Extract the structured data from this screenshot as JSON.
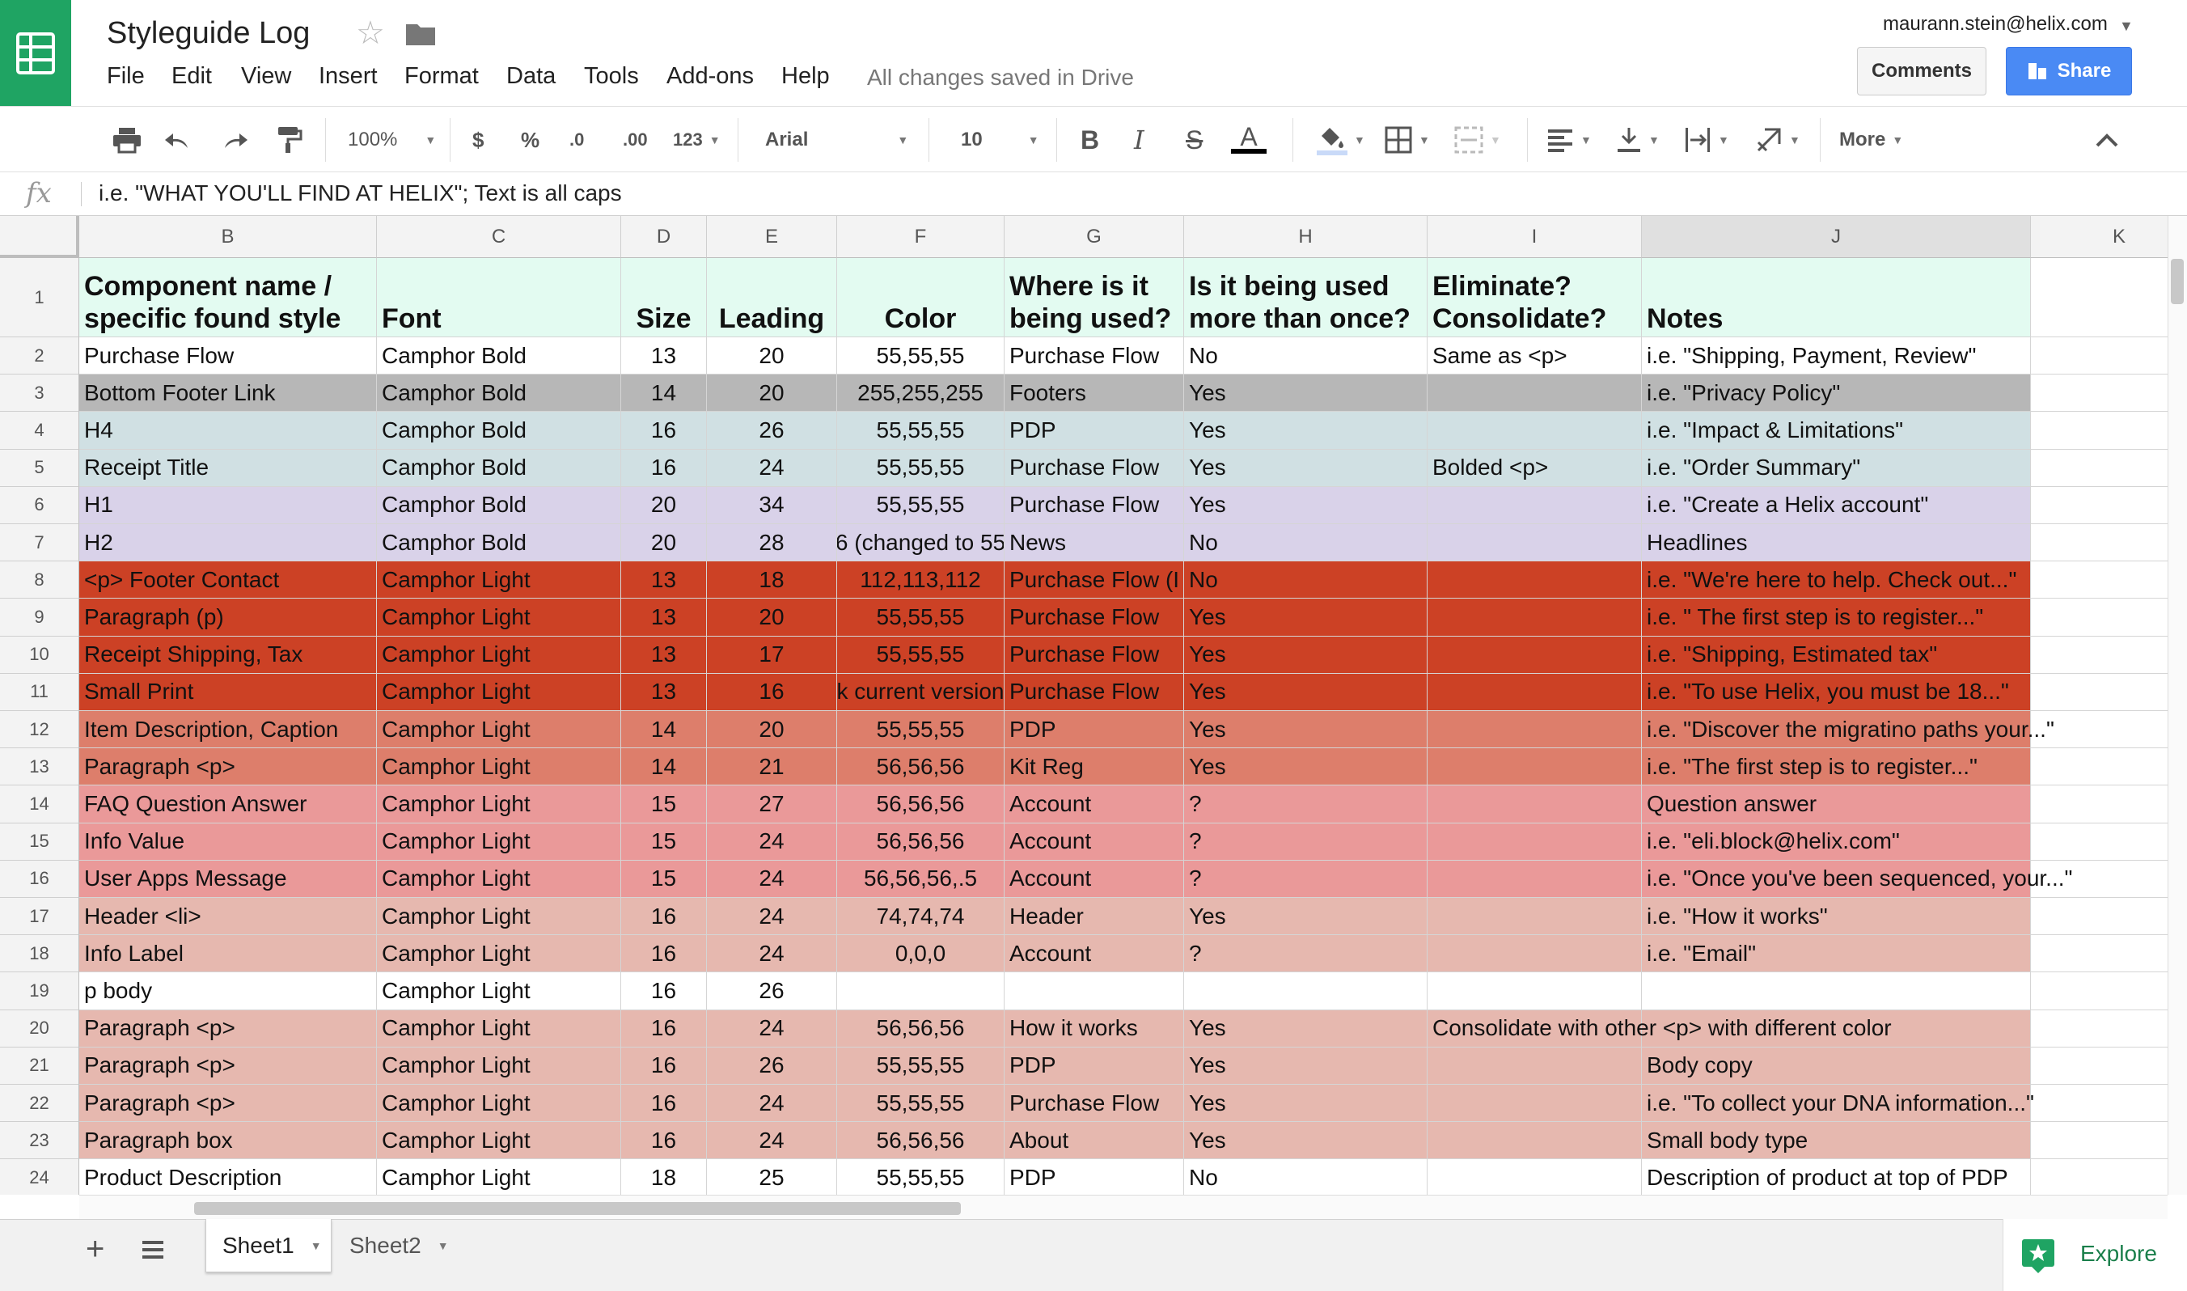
{
  "app": {
    "doc_title": "Styleguide Log",
    "saved_status": "All changes saved in Drive",
    "user_email": "maurann.stein@helix.com",
    "comments_label": "Comments",
    "share_label": "Share",
    "menu": [
      "File",
      "Edit",
      "View",
      "Insert",
      "Format",
      "Data",
      "Tools",
      "Add-ons",
      "Help"
    ],
    "brand_color": "#1fa463",
    "share_color": "#4a8af4"
  },
  "toolbar": {
    "zoom": "100%",
    "currency": "$",
    "percent": "%",
    "dec_decrease": ".0",
    "dec_increase": ".00",
    "number_format": "123",
    "font": "Arial",
    "font_size": "10",
    "bold": "B",
    "italic": "I",
    "strike": "S",
    "text_color": "A",
    "more": "More",
    "icons": [
      "print-icon",
      "undo-icon",
      "redo-icon",
      "paint-format-icon",
      "fill-color-icon",
      "borders-icon",
      "merge-cells-icon",
      "align-left-icon",
      "valign-bottom-icon",
      "text-wrap-icon",
      "text-rotate-icon",
      "collapse-icon"
    ]
  },
  "formula_bar": {
    "fx": "fx",
    "value": "i.e. \"WHAT YOU'LL FIND AT HELIX\"; Text is all caps"
  },
  "sheet": {
    "columns": [
      "B",
      "C",
      "D",
      "E",
      "F",
      "G",
      "H",
      "I",
      "J",
      "K"
    ],
    "rows": [
      {
        "n": "1",
        "bg": "#e3fbf1",
        "cells": [
          "Component name / specific found style",
          "Font",
          "Size",
          "Leading",
          "Color",
          "Where is it being used?",
          "Is it being used more than once?",
          "Eliminate? Consolidate?",
          "Notes",
          ""
        ]
      },
      {
        "n": "2",
        "bg": "#ffffff",
        "cells": [
          "Purchase Flow",
          "Camphor Bold",
          "13",
          "20",
          "55,55,55",
          "Purchase Flow",
          "No",
          "Same as <p>",
          "i.e. \"Shipping, Payment, Review\"",
          ""
        ]
      },
      {
        "n": "3",
        "bg": "#b7b7b7",
        "cells": [
          "Bottom Footer Link",
          "Camphor Bold",
          "14",
          "20",
          "255,255,255",
          "Footers",
          "Yes",
          "",
          "i.e. \"Privacy Policy\"",
          ""
        ]
      },
      {
        "n": "4",
        "bg": "#d0e0e3",
        "cells": [
          "H4",
          "Camphor Bold",
          "16",
          "26",
          "55,55,55",
          "PDP",
          "Yes",
          "",
          "i.e. \"Impact & Limitations\"",
          ""
        ]
      },
      {
        "n": "5",
        "bg": "#d0e0e3",
        "cells": [
          "Receipt Title",
          "Camphor Bold",
          "16",
          "24",
          "55,55,55",
          "Purchase Flow",
          "Yes",
          "Bolded <p>",
          "i.e. \"Order Summary\"",
          ""
        ]
      },
      {
        "n": "6",
        "bg": "#d9d2e9",
        "cells": [
          "H1",
          "Camphor Bold",
          "20",
          "34",
          "55,55,55",
          "Purchase Flow",
          "Yes",
          "",
          "i.e. \"Create a Helix account\"",
          ""
        ]
      },
      {
        "n": "7",
        "bg": "#d9d2e9",
        "cells": [
          "H2",
          "Camphor Bold",
          "20",
          "28",
          "6 (changed to 55",
          "News",
          "No",
          "",
          "Headlines",
          ""
        ]
      },
      {
        "n": "8",
        "bg": "#cc4125",
        "cells": [
          "<p> Footer Contact",
          "Camphor Light",
          "13",
          "18",
          "112,113,112",
          "Purchase Flow (I",
          "No",
          "",
          "i.e. \"We're here to help. Check out...\"",
          ""
        ]
      },
      {
        "n": "9",
        "bg": "#cc4125",
        "cells": [
          "Paragraph (p)",
          "Camphor Light",
          "13",
          "20",
          "55,55,55",
          "Purchase Flow",
          "Yes",
          "",
          "i.e. \" The first step is to register...\"",
          ""
        ]
      },
      {
        "n": "10",
        "bg": "#cc4125",
        "cells": [
          "Receipt Shipping, Tax",
          "Camphor Light",
          "13",
          "17",
          "55,55,55",
          "Purchase Flow",
          "Yes",
          "",
          "i.e. \"Shipping, Estimated tax\"",
          ""
        ]
      },
      {
        "n": "11",
        "bg": "#cc4125",
        "cells": [
          "Small Print",
          "Camphor Light",
          "13",
          "16",
          "k current version",
          "Purchase Flow",
          "Yes",
          "",
          "i.e. \"To use Helix, you must be 18...\"",
          ""
        ]
      },
      {
        "n": "12",
        "bg": "#dd7e6b",
        "cells": [
          "Item Description, Caption",
          "Camphor Light",
          "14",
          "20",
          "55,55,55",
          "PDP",
          "Yes",
          "",
          "i.e. \"Discover the migratino paths your...\"",
          ""
        ]
      },
      {
        "n": "13",
        "bg": "#dd7e6b",
        "cells": [
          "Paragraph <p>",
          "Camphor Light",
          "14",
          "21",
          "56,56,56",
          "Kit Reg",
          "Yes",
          "",
          "i.e. \"The first step is to register...\"",
          ""
        ]
      },
      {
        "n": "14",
        "bg": "#ea9999",
        "cells": [
          "FAQ Question Answer",
          "Camphor Light",
          "15",
          "27",
          "56,56,56",
          "Account",
          "?",
          "",
          "Question answer",
          ""
        ]
      },
      {
        "n": "15",
        "bg": "#ea9999",
        "cells": [
          "Info Value",
          "Camphor Light",
          "15",
          "24",
          "56,56,56",
          "Account",
          "?",
          "",
          "i.e. \"eli.block@helix.com\"",
          ""
        ]
      },
      {
        "n": "16",
        "bg": "#ea9999",
        "cells": [
          "User Apps Message",
          "Camphor Light",
          "15",
          "24",
          "56,56,56,.5",
          "Account",
          "?",
          "",
          "i.e. \"Once you've been sequenced, your...\"",
          ""
        ]
      },
      {
        "n": "17",
        "bg": "#e6b8af",
        "cells": [
          "Header <li>",
          "Camphor Light",
          "16",
          "24",
          "74,74,74",
          "Header",
          "Yes",
          "",
          "i.e. \"How it works\"",
          ""
        ]
      },
      {
        "n": "18",
        "bg": "#e6b8af",
        "cells": [
          "Info Label",
          "Camphor Light",
          "16",
          "24",
          "0,0,0",
          "Account",
          "?",
          "",
          "i.e. \"Email\"",
          ""
        ]
      },
      {
        "n": "19",
        "bg": "#ffffff",
        "cells": [
          "p body",
          "Camphor Light",
          "16",
          "26",
          "",
          "",
          "",
          "",
          "",
          ""
        ]
      },
      {
        "n": "20",
        "bg": "#e6b8af",
        "cells": [
          "Paragraph <p>",
          "Camphor Light",
          "16",
          "24",
          "56,56,56",
          "How it works",
          "Yes",
          "Consolidate with other <p> with different color",
          "",
          ""
        ]
      },
      {
        "n": "21",
        "bg": "#e6b8af",
        "cells": [
          "Paragraph <p>",
          "Camphor Light",
          "16",
          "26",
          "55,55,55",
          "PDP",
          "Yes",
          "",
          "Body copy",
          ""
        ]
      },
      {
        "n": "22",
        "bg": "#e6b8af",
        "cells": [
          "Paragraph <p>",
          "Camphor Light",
          "16",
          "24",
          "55,55,55",
          "Purchase Flow",
          "Yes",
          "",
          "i.e. \"To collect your DNA information...\"",
          ""
        ]
      },
      {
        "n": "23",
        "bg": "#e6b8af",
        "cells": [
          "Paragraph box",
          "Camphor Light",
          "16",
          "24",
          "56,56,56",
          "About",
          "Yes",
          "",
          "Small body type",
          ""
        ]
      },
      {
        "n": "24",
        "bg": "#ffffff",
        "cells": [
          "Product Description",
          "Camphor Light",
          "18",
          "25",
          "55,55,55",
          "PDP",
          "No",
          "",
          "Description of product at top of PDP",
          ""
        ]
      }
    ]
  },
  "bottom": {
    "tabs": [
      "Sheet1",
      "Sheet2"
    ],
    "explore_label": "Explore"
  }
}
